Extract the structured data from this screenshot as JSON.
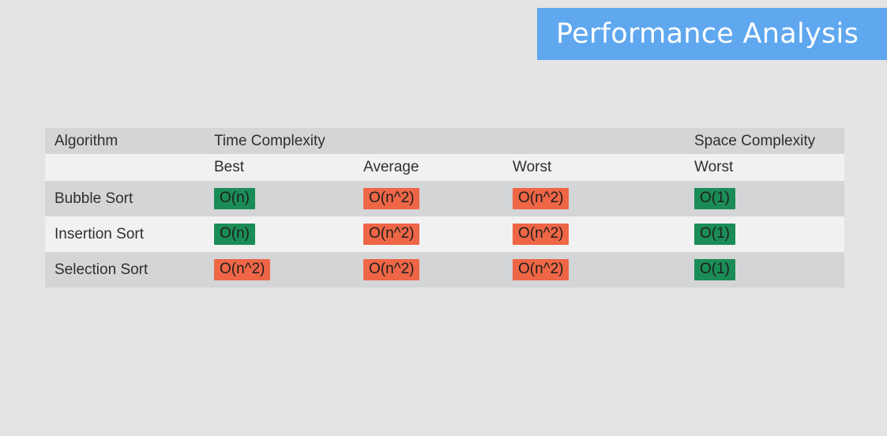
{
  "slide": {
    "title": "Performance Analysis"
  },
  "colors": {
    "banner": "#5fa7ef",
    "good": "#1b8c57",
    "bad": "#ee6646",
    "row_dark": "#d4d5d7",
    "row_light": "#f1f1f1"
  },
  "table": {
    "header_row_1": [
      "Algorithm",
      "Time Complexity",
      "",
      "",
      "Space Complexity"
    ],
    "header_row_2": [
      "",
      "Best",
      "Average",
      "Worst",
      "Worst"
    ],
    "rows": [
      {
        "algorithm": "Bubble Sort",
        "best": "O(n)",
        "best_class": "good",
        "average": "O(n^2)",
        "average_class": "bad",
        "worst": "O(n^2)",
        "worst_class": "bad",
        "space": "O(1)",
        "space_class": "good"
      },
      {
        "algorithm": "Insertion Sort",
        "best": "O(n)",
        "best_class": "good",
        "average": "O(n^2)",
        "average_class": "bad",
        "worst": "O(n^2)",
        "worst_class": "bad",
        "space": "O(1)",
        "space_class": "good"
      },
      {
        "algorithm": "Selection Sort",
        "best": "O(n^2)",
        "best_class": "bad",
        "average": "O(n^2)",
        "average_class": "bad",
        "worst": "O(n^2)",
        "worst_class": "bad",
        "space": "O(1)",
        "space_class": "good"
      }
    ]
  }
}
